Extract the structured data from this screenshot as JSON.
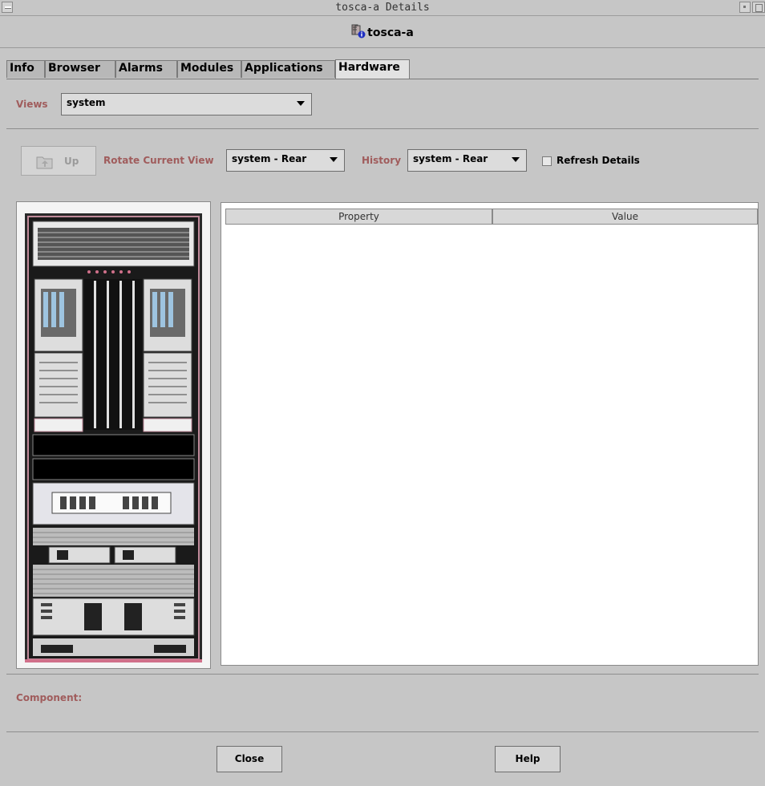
{
  "window": {
    "title": "tosca-a Details"
  },
  "host": {
    "name": "tosca-a",
    "icon": "server-info-icon"
  },
  "tabs": [
    {
      "label": "Info",
      "active": false
    },
    {
      "label": "Browser",
      "active": false
    },
    {
      "label": "Alarms",
      "active": false
    },
    {
      "label": "Modules",
      "active": false
    },
    {
      "label": "Applications",
      "active": false
    },
    {
      "label": "Hardware",
      "active": true
    }
  ],
  "views": {
    "label": "Views",
    "value": "system"
  },
  "toolbar": {
    "up_label": "Up",
    "rotate_label": "Rotate Current View",
    "rotate_value": "system - Rear",
    "history_label": "History",
    "history_value": "system - Rear",
    "refresh_label": "Refresh Details",
    "refresh_checked": false
  },
  "table": {
    "columns": [
      "Property",
      "Value"
    ],
    "rows": []
  },
  "component": {
    "label": "Component:"
  },
  "footer": {
    "close_label": "Close",
    "help_label": "Help"
  }
}
